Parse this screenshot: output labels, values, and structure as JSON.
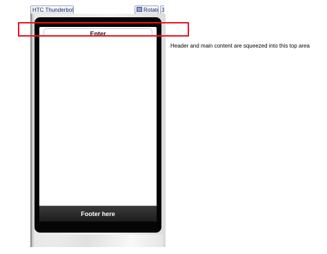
{
  "toolbar": {
    "device_label": "HTC Thunderbolt",
    "device_chevron": "▾",
    "rotate_label": "Rotate",
    "partial_label": "3"
  },
  "app": {
    "header_title": "Enter",
    "footer_text": "Footer here"
  },
  "annotation": {
    "text": "Header and main content are squeezed into this top area",
    "highlight_color": "#e8141c"
  },
  "icons": {
    "rotate": "rotate-icon",
    "chevron": "chevron-down-icon"
  }
}
